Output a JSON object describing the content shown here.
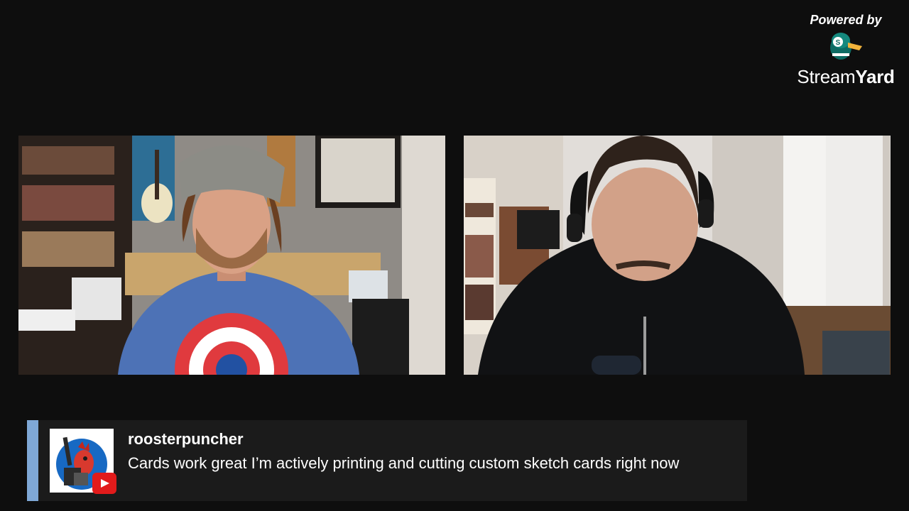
{
  "branding": {
    "powered_by": "Powered by",
    "name_part1": "Stream",
    "name_part2": "Yard",
    "logo_icon": "duck-icon"
  },
  "participants": [
    {
      "id": "host",
      "icon": "video-feed"
    },
    {
      "id": "guest",
      "icon": "video-feed"
    }
  ],
  "comment": {
    "author": "roosterpuncher",
    "text": "Cards work great I’m actively printing and cutting custom sketch cards right now",
    "platform_icon": "youtube-icon",
    "accent_color": "#7fa8d6"
  },
  "colors": {
    "background": "#0e0e0e",
    "banner": "#1b1b1b",
    "youtube_red": "#e21b1b"
  }
}
